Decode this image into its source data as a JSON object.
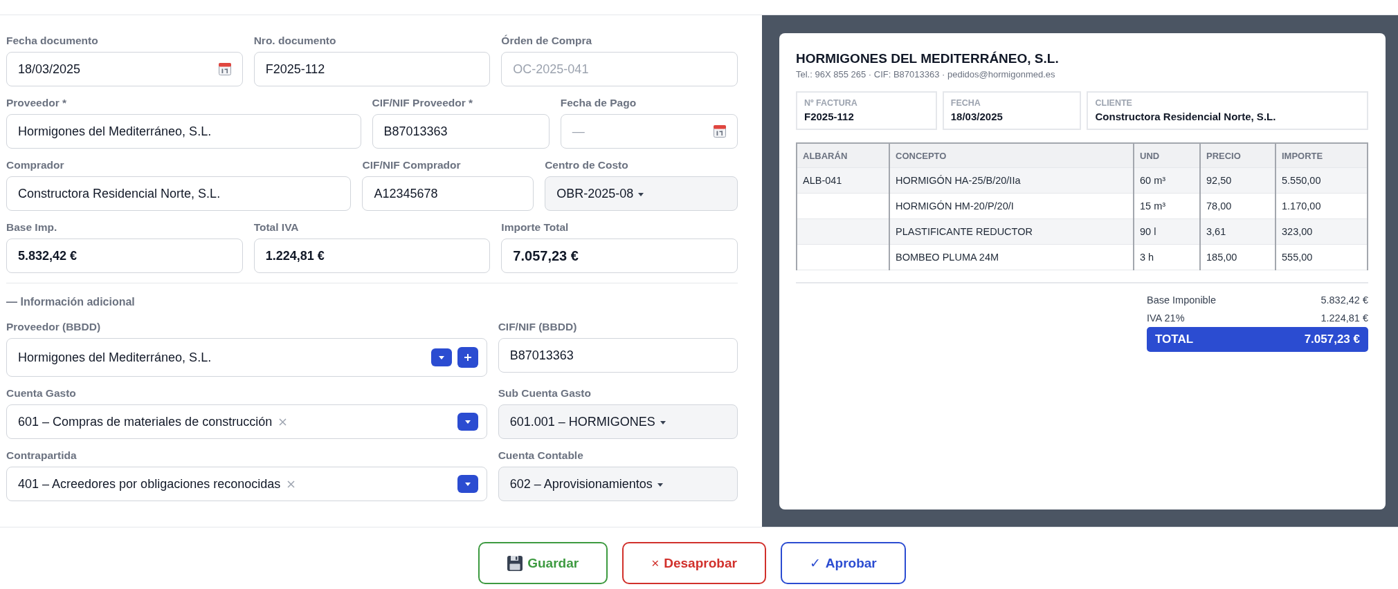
{
  "form": {
    "rows": [
      [
        {
          "label": "Fecha documento",
          "kind": "date",
          "value": "18/03/2025"
        },
        {
          "label": "Nro. documento",
          "kind": "text",
          "value": "F2025-112"
        },
        {
          "label": "Órden de Compra",
          "kind": "text",
          "placeholder": "OC-2025-041"
        }
      ],
      [
        {
          "label": "Proveedor *",
          "kind": "text",
          "value": "Hormigones del Mediterráneo, S.L."
        },
        {
          "label": "CIF/NIF Proveedor *",
          "kind": "text",
          "value": "B87013363"
        },
        {
          "label": "Fecha de Pago",
          "kind": "date",
          "placeholder": "—"
        }
      ],
      [
        {
          "label": "Comprador",
          "kind": "text",
          "value": "Constructora Residencial Norte, S.L."
        },
        {
          "label": "CIF/NIF Comprador",
          "kind": "text",
          "value": "A12345678"
        },
        {
          "label": "Centro de Costo",
          "kind": "select",
          "value": "OBR-2025-08"
        }
      ],
      [
        {
          "label": "Base Imp.",
          "kind": "amount",
          "value": "5.832,42 €"
        },
        {
          "label": "Total IVA",
          "kind": "amount",
          "value": "1.224,81 €"
        },
        {
          "label": "Importe Total",
          "kind": "total",
          "value": "7.057,23 €"
        }
      ]
    ]
  },
  "additional": {
    "title": "— Información adicional",
    "rows": [
      [
        {
          "label": "Proveedor (BBDD)",
          "kind": "lookup",
          "value": "Hormigones del Mediterráneo, S.L."
        },
        {
          "label": "CIF/NIF (BBDD)",
          "kind": "text",
          "value": "B87013363"
        }
      ],
      [
        {
          "label": "Cuenta Gasto",
          "kind": "clearable",
          "value": "601 – Compras de materiales de construcción"
        },
        {
          "label": "Sub Cuenta Gasto",
          "kind": "select",
          "value": "601.001 – HORMIGONES"
        }
      ],
      [
        {
          "label": "Contrapartida",
          "kind": "clearable",
          "value": "401 – Acreedores por obligaciones reconocidas"
        },
        {
          "label": "Cuenta Contable",
          "kind": "select",
          "value": "602 – Aprovisionamientos"
        }
      ]
    ]
  },
  "invoice": {
    "company": "HORMIGONES DEL MEDITERRÁNEO, S.L.",
    "contact": "Tel.: 96X 855 265 · CIF: B87013363 · pedidos@hormigonmed.es",
    "meta": [
      {
        "label": "Nº FACTURA",
        "value": "F2025-112"
      },
      {
        "label": "FECHA",
        "value": "18/03/2025"
      },
      {
        "label": "CLIENTE",
        "value": "Constructora Residencial Norte, S.L."
      }
    ],
    "table": {
      "columns": [
        "ALBARÁN",
        "CONCEPTO",
        "UND",
        "PRECIO",
        "IMPORTE"
      ],
      "rows": [
        {
          "delivery_note": "ALB-041",
          "concept": "HORMIGÓN HA-25/B/20/IIa",
          "unit": "60 m³",
          "price": "92,50",
          "amount": "5.550,00"
        },
        {
          "concept": "HORMIGÓN HM-20/P/20/I",
          "unit": "15 m³",
          "price": "78,00",
          "amount": "1.170,00"
        },
        {
          "concept": "PLASTIFICANTE REDUCTOR",
          "unit": "90 l",
          "price": "3,61",
          "amount": "323,00"
        },
        {
          "concept": "BOMBEO PLUMA 24M",
          "unit": "3 h",
          "price": "185,00",
          "amount": "555,00"
        }
      ]
    },
    "totals": [
      {
        "label": "Base Imponible",
        "value": "5.832,42 €"
      },
      {
        "label": "IVA 21%",
        "value": "1.224,81 €"
      }
    ],
    "grand_total": {
      "label": "TOTAL",
      "value": "7.057,23 €"
    }
  },
  "actions": [
    {
      "kind": "save",
      "label": "Guardar"
    },
    {
      "kind": "reject",
      "icon": "×",
      "label": "Desaprobar"
    },
    {
      "kind": "approve",
      "icon": "✓",
      "label": "Aprobar"
    }
  ]
}
